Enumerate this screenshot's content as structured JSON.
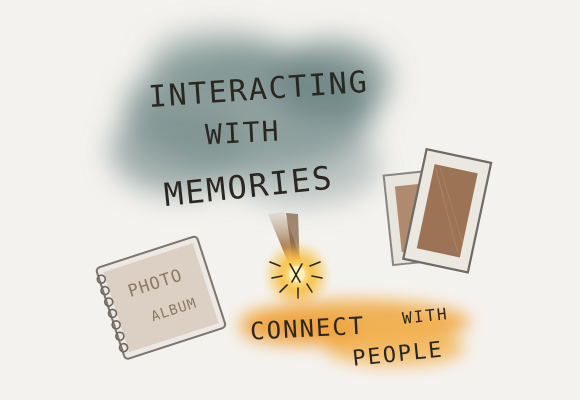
{
  "headline": {
    "line1": "INTERACTING",
    "line2": "WITH",
    "line3": "MEMORIES"
  },
  "album": {
    "line1": "PHOTO",
    "line2": "ALBUM"
  },
  "connect": {
    "line1": "CONNECT",
    "line2": "WITH",
    "line3": "PEOPLE"
  },
  "colors": {
    "background": "#f4f2ef",
    "cloud": "#6f8684",
    "spark": "#f2b640",
    "highlight": "#f0a63a",
    "frame_inner": "#9c7355",
    "ink": "#2a2622"
  }
}
